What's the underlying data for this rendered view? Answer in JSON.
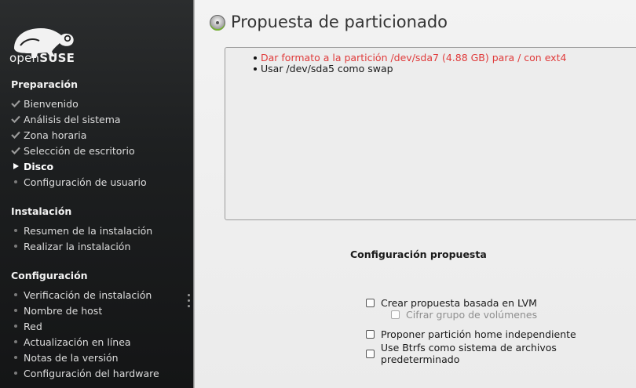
{
  "sidebar": {
    "logo_text_open": "open",
    "logo_text_suse": "SUSE",
    "sections": [
      {
        "title": "Preparación",
        "items": [
          {
            "label": "Bienvenido",
            "state": "done"
          },
          {
            "label": "Análisis del sistema",
            "state": "done"
          },
          {
            "label": "Zona horaria",
            "state": "done"
          },
          {
            "label": "Selección de escritorio",
            "state": "done"
          },
          {
            "label": "Disco",
            "state": "current"
          },
          {
            "label": "Configuración de usuario",
            "state": "pending"
          }
        ]
      },
      {
        "title": "Instalación",
        "items": [
          {
            "label": "Resumen de la instalación",
            "state": "pending"
          },
          {
            "label": "Realizar la instalación",
            "state": "pending"
          }
        ]
      },
      {
        "title": "Configuración",
        "items": [
          {
            "label": "Verificación de instalación",
            "state": "pending"
          },
          {
            "label": "Nombre de host",
            "state": "pending"
          },
          {
            "label": "Red",
            "state": "pending"
          },
          {
            "label": "Actualización en línea",
            "state": "pending"
          },
          {
            "label": "Notas de la versión",
            "state": "pending"
          },
          {
            "label": "Configuración del hardware",
            "state": "pending"
          }
        ]
      }
    ]
  },
  "main": {
    "title": "Propuesta de particionado",
    "icon": "disk-partition-icon",
    "summary": [
      {
        "text": "Dar formato a la partición /dev/sda7 (4.88 GB) para / con ext4",
        "warning": true
      },
      {
        "text": "Usar /dev/sda5 como swap",
        "warning": false
      }
    ],
    "config_heading": "Configuración propuesta",
    "options": [
      {
        "label": "Crear propuesta basada en LVM",
        "checked": false,
        "enabled": true
      },
      {
        "label": "Cifrar grupo de volúmenes",
        "checked": false,
        "enabled": false
      },
      {
        "label": "Proponer partición home independiente",
        "checked": false,
        "enabled": true
      },
      {
        "label": "Use Btrfs como sistema de archivos predeterminado",
        "checked": false,
        "enabled": true
      }
    ]
  },
  "colors": {
    "sidebar_bg": "#1d1f20",
    "warning_text": "#e03b3b",
    "logo_green": "#73ba25"
  }
}
